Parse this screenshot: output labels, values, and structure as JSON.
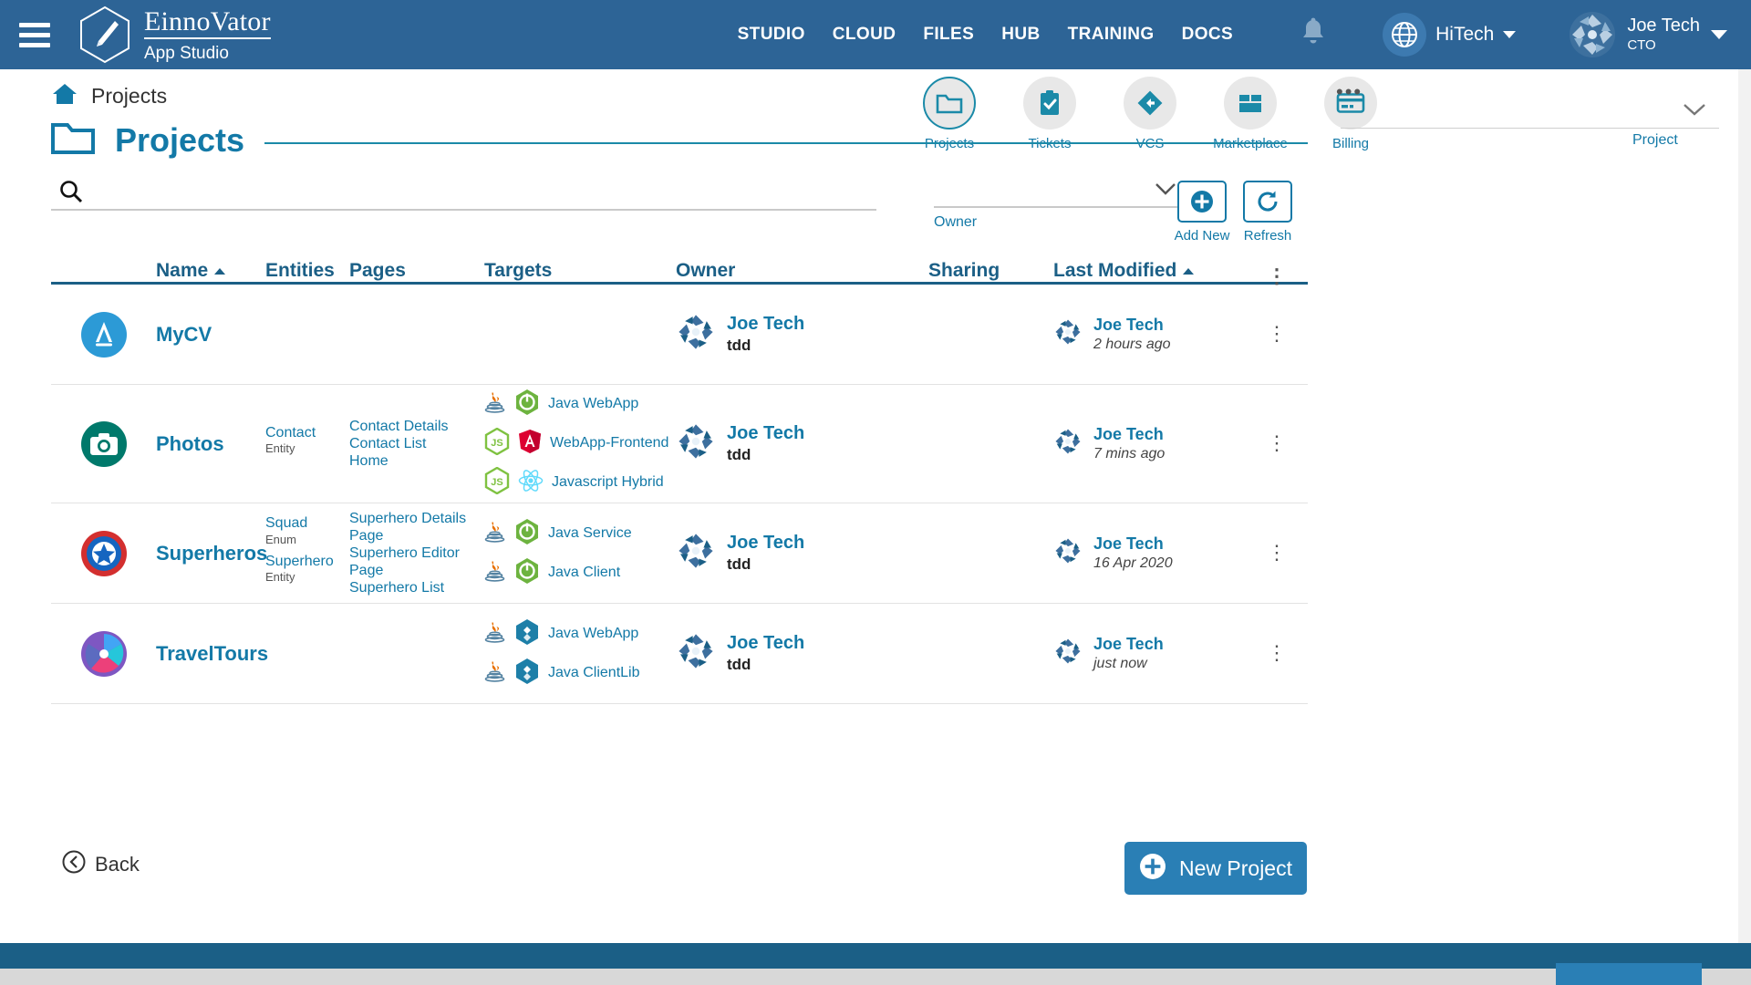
{
  "brand": {
    "title": "EinnoVator",
    "subtitle": "App Studio"
  },
  "topnav": {
    "items": [
      {
        "label": "STUDIO"
      },
      {
        "label": "CLOUD"
      },
      {
        "label": "FILES"
      },
      {
        "label": "HUB"
      },
      {
        "label": "TRAINING"
      },
      {
        "label": "DOCS"
      }
    ],
    "tenant": "HiTech",
    "user": {
      "name": "Joe Tech",
      "role": "CTO"
    }
  },
  "breadcrumb": {
    "label": "Projects"
  },
  "page": {
    "title": "Projects"
  },
  "icontabs": [
    {
      "label": "Projects",
      "icon": "folder-icon",
      "active": true
    },
    {
      "label": "Tickets",
      "icon": "clipboard-check-icon",
      "active": false
    },
    {
      "label": "VCS",
      "icon": "git-icon",
      "active": false
    },
    {
      "label": "Marketplace",
      "icon": "store-icon",
      "active": false
    },
    {
      "label": "Billing",
      "icon": "credit-card-icon",
      "active": false
    }
  ],
  "right_panel": {
    "dots": "•••",
    "label": "Project"
  },
  "search": {
    "value": "",
    "placeholder": ""
  },
  "owner_filter": {
    "value": "",
    "label": "Owner"
  },
  "actions": [
    {
      "label": "Add New",
      "icon": "plus-circle-icon"
    },
    {
      "label": "Refresh",
      "icon": "refresh-icon"
    }
  ],
  "table": {
    "columns": [
      {
        "key": "icon",
        "label": ""
      },
      {
        "key": "name",
        "label": "Name",
        "sort": "asc"
      },
      {
        "key": "entities",
        "label": "Entities"
      },
      {
        "key": "pages",
        "label": "Pages"
      },
      {
        "key": "targets",
        "label": "Targets"
      },
      {
        "key": "owner",
        "label": "Owner"
      },
      {
        "key": "sharing",
        "label": "Sharing"
      },
      {
        "key": "modified",
        "label": "Last Modified",
        "sort": "asc"
      }
    ],
    "rows": [
      {
        "icon": "appstore-icon",
        "name": "MyCV",
        "entities": [],
        "pages": [],
        "targets": [],
        "owner": {
          "name": "Joe Tech",
          "sub": "tdd"
        },
        "sharing": "",
        "modified": {
          "name": "Joe Tech",
          "when": "2 hours ago"
        }
      },
      {
        "icon": "camera-icon",
        "name": "Photos",
        "entities": [
          {
            "name": "Contact",
            "kind": "Entity"
          }
        ],
        "pages": [
          "Contact Details",
          "Contact List",
          "Home"
        ],
        "targets": [
          {
            "label": "Java WebApp",
            "icons": [
              "java-icon",
              "spring-icon"
            ]
          },
          {
            "label": "WebApp-Frontend",
            "icons": [
              "nodejs-icon",
              "angular-icon"
            ]
          },
          {
            "label": "Javascript Hybrid",
            "icons": [
              "nodejs-icon",
              "react-icon"
            ]
          }
        ],
        "owner": {
          "name": "Joe Tech",
          "sub": "tdd"
        },
        "sharing": "",
        "modified": {
          "name": "Joe Tech",
          "when": "7 mins ago"
        }
      },
      {
        "icon": "shield-star-icon",
        "name": "Superheros",
        "entities": [
          {
            "name": "Squad",
            "kind": "Enum"
          },
          {
            "name": "Superhero",
            "kind": "Entity"
          }
        ],
        "pages": [
          "Superhero Details Page",
          "Superhero Editor Page",
          "Superhero List"
        ],
        "targets": [
          {
            "label": "Java Service",
            "icons": [
              "java-icon",
              "spring-icon"
            ]
          },
          {
            "label": "Java Client",
            "icons": [
              "java-icon",
              "spring-icon"
            ]
          }
        ],
        "owner": {
          "name": "Joe Tech",
          "sub": "tdd"
        },
        "sharing": "",
        "modified": {
          "name": "Joe Tech",
          "when": "16 Apr 2020"
        }
      },
      {
        "icon": "travel-icon",
        "name": "TravelTours",
        "entities": [],
        "pages": [],
        "targets": [
          {
            "label": "Java WebApp",
            "icons": [
              "java-icon",
              "hexagon-blue-icon"
            ]
          },
          {
            "label": "Java ClientLib",
            "icons": [
              "java-icon",
              "hexagon-blue-icon"
            ]
          }
        ],
        "owner": {
          "name": "Joe Tech",
          "sub": "tdd"
        },
        "sharing": "",
        "modified": {
          "name": "Joe Tech",
          "when": "just now"
        }
      }
    ]
  },
  "footer": {
    "back_label": "Back",
    "new_project_label": "New Project"
  },
  "colors": {
    "header_blue": "#2d6496",
    "accent_teal": "#1379a7",
    "rule_blue": "#1b5f86",
    "button_blue": "#2a7fb5"
  }
}
